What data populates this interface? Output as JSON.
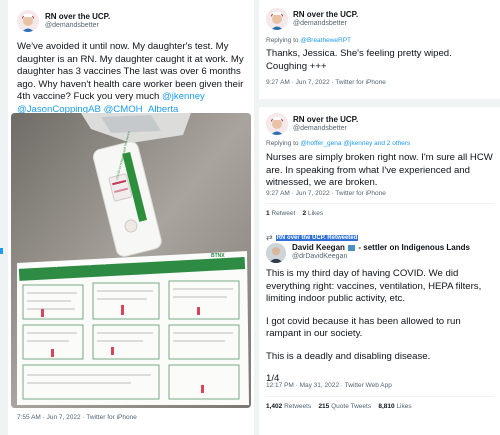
{
  "tweet1": {
    "name": "RN over the UCP.",
    "handle": "@demandsbetter",
    "text": "We've avoided it until now.  My daughter's test. My daughter is an RN. My daughter caught it at work. My daughter has 3 vaccines The last was over 6 months ago. Why haven't health care worker been given their 4th vaccine?  Fuck you very much",
    "mentions": [
      "@jkenney",
      "@JasonCoppingAB",
      "@CMOH_Alberta"
    ],
    "timestamp": "7:55 AM · Jun 7, 2022 · Twitter for iPhone",
    "photo": {
      "test_label": "COVID-19 Antigen Rapid Test Device",
      "sheet_title": "Reference Card | COVID-19 Antigen Rapid Test Device",
      "brand": "BTNX"
    }
  },
  "tweet2": {
    "name": "RN over the UCP.",
    "handle": "@demandsbetter",
    "reply_prefix": "Replying to",
    "reply_to": "@BreatheweRPT",
    "text": "Thanks, Jessica.  She's feeling pretty wiped. Coughing +++",
    "timestamp": "9:27 AM · Jun 7, 2022 · Twitter for iPhone"
  },
  "tweet3": {
    "name": "RN over the UCP.",
    "handle": "@demandsbetter",
    "reply_prefix": "Replying to",
    "reply_to": "@hoffer_gena @jkenney and 2 others",
    "text": "Nurses are simply broken right now. I'm sure all HCW are. In speaking from what I've experienced and witnessed, we are broken.",
    "timestamp": "9:27 AM · Jun 7, 2022 · Twitter for iPhone",
    "retweets_count": "1",
    "retweets_label": "Retweet",
    "likes_count": "2",
    "likes_label": "Likes"
  },
  "retweet": {
    "retweeted_by": "RN over the UCP. Retweeted",
    "name": "David Keegan",
    "name_suffix": "- settler on Indigenous Lands",
    "handle": "@drDavidKeegan",
    "paragraph1": "This is my third day of having COVID.  We did everything right: vaccines, ventilation, HEPA filters, limiting indoor public activity, etc.",
    "paragraph2": "I got covid because it has been allowed to run rampant in our society.",
    "paragraph3": "This is a deadly and disabling disease.",
    "paragraph4": "1/4",
    "timestamp": "12:17 PM · May 31, 2022 · Twitter Web App",
    "retweets_count": "1,402",
    "retweets_label": "Retweets",
    "quotes_count": "215",
    "quotes_label": "Quote Tweets",
    "likes_count": "8,810",
    "likes_label": "Likes"
  }
}
